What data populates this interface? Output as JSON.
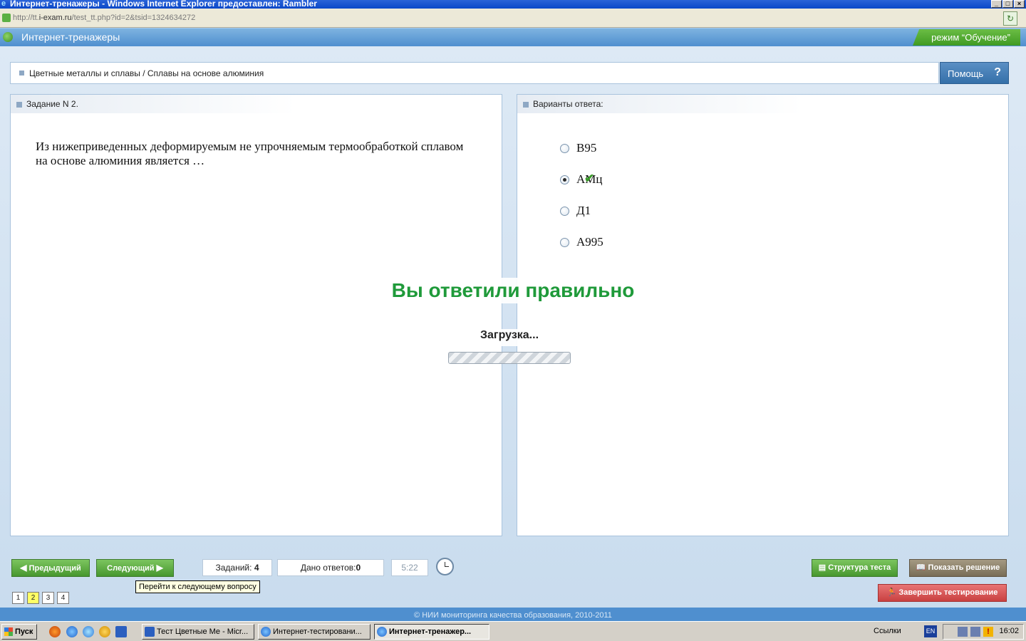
{
  "browser": {
    "title": "Интернет-тренажеры - Windows Internet Explorer предоставлен: Rambler",
    "url_prefix": "http://tt.",
    "url_domain": "i-exam.ru",
    "url_path": "/test_tt.php?id=2&tsid=1324634272"
  },
  "header": {
    "app_title": "Интернет-тренажеры",
    "mode": "режим “Обучение”"
  },
  "breadcrumb": "Цветные металлы и сплавы / Сплавы на основе алюминия",
  "help_label": "Помощь",
  "help_icon": "?",
  "task": {
    "header": "Задание N 2.",
    "text": "Из нижеприведенных деформируемым не упрочняемым термообработкой сплавом на основе алюминия является …"
  },
  "answers": {
    "header": "Варианты ответа:",
    "options": [
      {
        "label": "В95",
        "selected": false,
        "correct": false
      },
      {
        "label": "АМц",
        "selected": true,
        "correct": true
      },
      {
        "label": "Д1",
        "selected": false,
        "correct": false
      },
      {
        "label": "А995",
        "selected": false,
        "correct": false
      }
    ],
    "check_icon": "check-icon"
  },
  "feedback": {
    "result": "Вы ответили правильно",
    "loading": "Загрузка..."
  },
  "toolbar": {
    "prev_label": "Предыдущий",
    "next_label": "Следующий",
    "tasks_label": "Заданий:",
    "tasks_count": "4",
    "answers_label": "Дано ответов:",
    "answers_count": "0",
    "timer": "5:22",
    "tooltip": "Перейти к следующему вопросу",
    "question_numbers": [
      "1",
      "2",
      "3",
      "4"
    ],
    "current_question": "2",
    "structure_label": "Структура теста",
    "solution_label": "Показать решение",
    "finish_label": "Завершить тестирование"
  },
  "footer": "© НИИ мониторинга качества образования, 2010-2011",
  "taskbar": {
    "start_label": "Пуск",
    "tasks": [
      "Тест Цветные Ме - Micr...",
      "Интернет-тестировани...",
      "Интернет-тренажер..."
    ],
    "links_label": "Ссылки",
    "lang": "EN",
    "clock": "16:02"
  },
  "colors": {
    "accent_blue": "#4f8fcf",
    "mode_green": "#47972e",
    "result_green": "#1f9a3a",
    "finish_red": "#c94141",
    "solution_brown": "#786d56"
  }
}
